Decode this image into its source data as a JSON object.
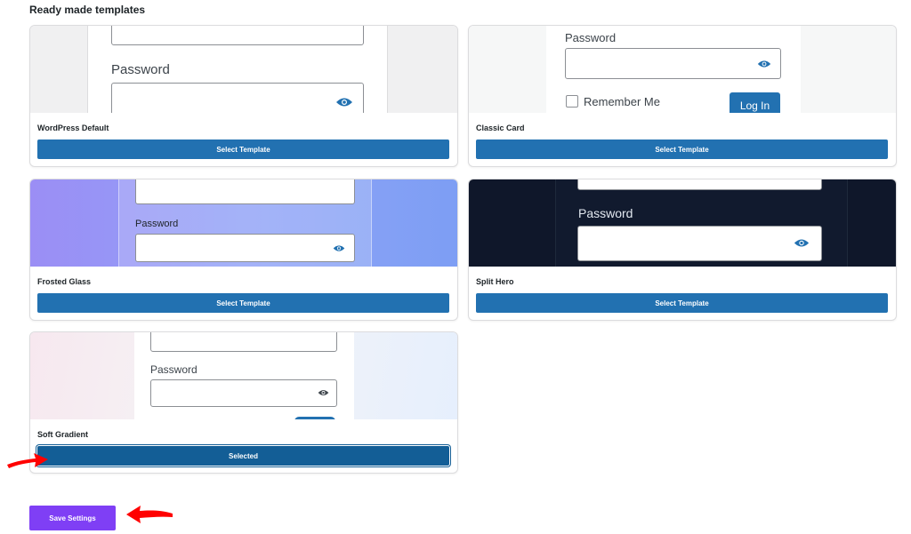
{
  "page": {
    "heading": "Ready made templates",
    "save_label": "Save Settings"
  },
  "templates": [
    {
      "name": "WordPress Default",
      "button": "Select Template",
      "preview": {
        "password_label": "Password"
      }
    },
    {
      "name": "Classic Card",
      "button": "Select Template",
      "preview": {
        "password_label": "Password",
        "remember_label": "Remember Me",
        "login_label": "Log In"
      }
    },
    {
      "name": "Frosted Glass",
      "button": "Select Template",
      "preview": {
        "password_label": "Password"
      }
    },
    {
      "name": "Split Hero",
      "button": "Select Template",
      "preview": {
        "password_label": "Password"
      }
    },
    {
      "name": "Soft Gradient",
      "button": "Selected",
      "preview": {
        "password_label": "Password"
      }
    }
  ],
  "colors": {
    "primary_button": "#2271b1",
    "selected_button": "#135e96",
    "save_button": "#7f3ff5",
    "annotation_arrow": "#ff0000",
    "split_hero_bg": "#0f172a"
  },
  "icons": [
    "eye-icon",
    "checkbox-icon",
    "arrow-icon"
  ]
}
